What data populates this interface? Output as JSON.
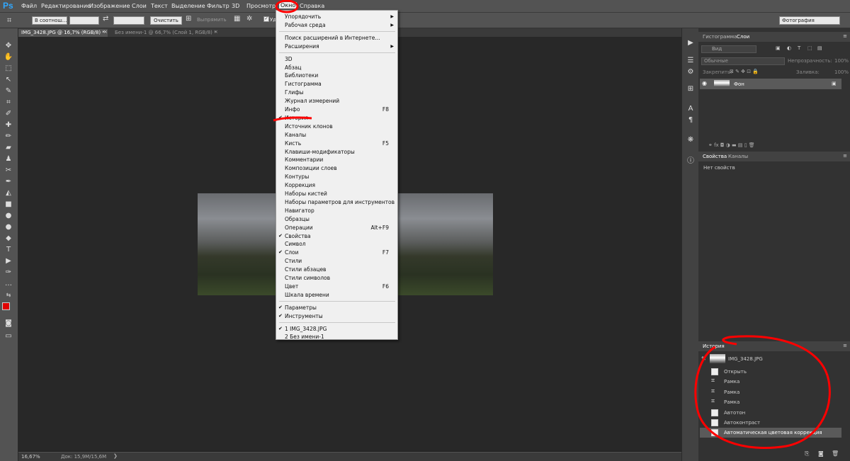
{
  "app": {
    "logo": "Ps"
  },
  "menubar": {
    "items": [
      "Файл",
      "Редактирование",
      "Изображение",
      "Слои",
      "Текст",
      "Выделение",
      "Фильтр",
      "3D",
      "Просмотр",
      "Окно",
      "Справка"
    ]
  },
  "options": {
    "ratio": "В соотнош...",
    "clear": "Очистить",
    "straighten": "Выпрямить",
    "delete_crop_label": "Уд",
    "workspace": "Фотография"
  },
  "tabs": [
    "IMG_3428.JPG @ 16,7% (RGB/8) *",
    "Без имени-1 @ 66,7% (Слой 1, RGB/8) *"
  ],
  "status": {
    "zoom": "16,67%",
    "doc": "Док: 15,9M/15,6M"
  },
  "window_menu": {
    "items": [
      {
        "label": "Упорядочить",
        "sub": true
      },
      {
        "label": "Рабочая среда",
        "sub": true
      },
      {
        "sep": true
      },
      {
        "label": "Поиск расширений в Интернете..."
      },
      {
        "label": "Расширения",
        "sub": true
      },
      {
        "sep": true
      },
      {
        "label": "3D"
      },
      {
        "label": "Абзац"
      },
      {
        "label": "Библиотеки"
      },
      {
        "label": "Гистограмма"
      },
      {
        "label": "Глифы"
      },
      {
        "label": "Журнал измерений"
      },
      {
        "label": "Инфо",
        "sc": "F8"
      },
      {
        "label": "История",
        "check": true
      },
      {
        "label": "Источник клонов"
      },
      {
        "label": "Каналы"
      },
      {
        "label": "Кисть",
        "sc": "F5"
      },
      {
        "label": "Клавиши-модификаторы"
      },
      {
        "label": "Комментарии"
      },
      {
        "label": "Композиции слоев"
      },
      {
        "label": "Контуры"
      },
      {
        "label": "Коррекция"
      },
      {
        "label": "Наборы кистей"
      },
      {
        "label": "Наборы параметров для инструментов"
      },
      {
        "label": "Навигатор"
      },
      {
        "label": "Образцы"
      },
      {
        "label": "Операции",
        "sc": "Alt+F9"
      },
      {
        "label": "Свойства",
        "check": true
      },
      {
        "label": "Символ"
      },
      {
        "label": "Слои",
        "check": true,
        "sc": "F7"
      },
      {
        "label": "Стили"
      },
      {
        "label": "Стили абзацев"
      },
      {
        "label": "Стили символов"
      },
      {
        "label": "Цвет",
        "sc": "F6"
      },
      {
        "label": "Шкала времени"
      },
      {
        "sep": true
      },
      {
        "label": "Параметры",
        "check": true
      },
      {
        "label": "Инструменты",
        "check": true
      },
      {
        "sep": true
      },
      {
        "label": "1 IMG_3428.JPG",
        "check": true
      },
      {
        "label": "2 Без имени-1"
      }
    ]
  },
  "layers_panel": {
    "tabs": [
      "Гистограмма",
      "Слои"
    ],
    "filter": "Вид",
    "blend": "Обычные",
    "opacity_label": "Непрозрачность:",
    "opacity": "100%",
    "lock_label": "Закрепить:",
    "fill_label": "Заливка:",
    "fill": "100%",
    "layer_name": "Фон"
  },
  "properties_panel": {
    "tabs": [
      "Свойства",
      "Каналы"
    ],
    "empty": "Нет свойств"
  },
  "history_panel": {
    "title": "История",
    "snapshot": "IMG_3428.JPG",
    "steps": [
      "Открыть",
      "Рамка",
      "Рамка",
      "Рамка",
      "Автотон",
      "Автоконтраст",
      "Автоматическая цветовая коррекция"
    ]
  },
  "colors": {
    "accent": "#31a8ff",
    "annotation": "#ff0000",
    "fg_swatch": "#e00000"
  }
}
